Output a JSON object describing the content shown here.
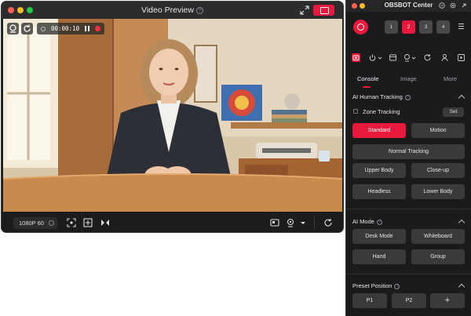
{
  "preview": {
    "title": "Video Preview",
    "help_glyph": "?",
    "record_time": "00:00:10",
    "resolution": "1080P 60",
    "icons": [
      "camera-switch-icon",
      "refresh-icon",
      "expand-icon",
      "pip-window-icon",
      "focus-icon",
      "grid-icon",
      "flip-icon",
      "virtual-camera-icon",
      "webcam-icon",
      "rotate-icon"
    ]
  },
  "center": {
    "title": "OBSBOT Center",
    "devices": [
      "1",
      "2",
      "3",
      "4"
    ],
    "active_device": "2",
    "tabs": [
      "Console",
      "Image",
      "More"
    ],
    "active_tab": "Console",
    "tracking": {
      "header": "AI Human Tracking",
      "zone_label": "Zone Tracking",
      "set_label": "Set",
      "modes": [
        "Standard",
        "Motion"
      ],
      "normal_label": "Normal Tracking",
      "framing": [
        "Upper Body",
        "Close-up",
        "Headless",
        "Lower Body"
      ]
    },
    "ai_mode": {
      "header": "AI Mode",
      "options": [
        "Desk Mode",
        "Whiteboard",
        "Hand",
        "Group"
      ]
    },
    "preset": {
      "header": "Preset Position",
      "positions": [
        "P1",
        "P2"
      ],
      "add_label": "+"
    }
  },
  "colors": {
    "accent": "#e8193c",
    "panel_bg": "#1b1b1d",
    "button_bg": "#3a3a3c"
  }
}
